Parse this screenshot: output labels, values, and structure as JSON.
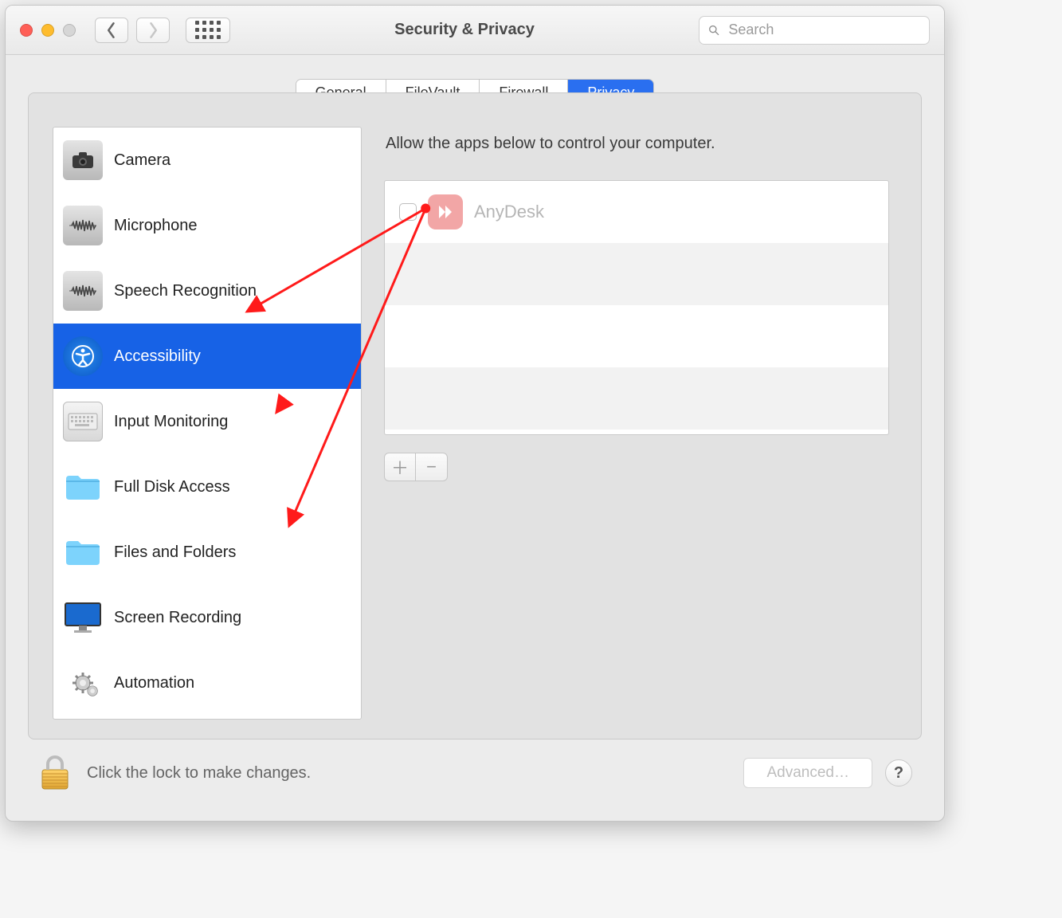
{
  "window": {
    "title": "Security & Privacy"
  },
  "search": {
    "placeholder": "Search"
  },
  "tabs": {
    "general": "General",
    "filevault": "FileVault",
    "firewall": "Firewall",
    "privacy": "Privacy"
  },
  "sidebar": {
    "items": [
      {
        "label": "Camera"
      },
      {
        "label": "Microphone"
      },
      {
        "label": "Speech Recognition"
      },
      {
        "label": "Accessibility"
      },
      {
        "label": "Input Monitoring"
      },
      {
        "label": "Full Disk Access"
      },
      {
        "label": "Files and Folders"
      },
      {
        "label": "Screen Recording"
      },
      {
        "label": "Automation"
      }
    ]
  },
  "right": {
    "header": "Allow the apps below to control your computer.",
    "apps": [
      {
        "name": "AnyDesk",
        "checked": false
      }
    ]
  },
  "footer": {
    "lock_text": "Click the lock to make changes.",
    "advanced": "Advanced…",
    "help": "?"
  },
  "icons": {
    "plus": "＋",
    "minus": "−"
  }
}
